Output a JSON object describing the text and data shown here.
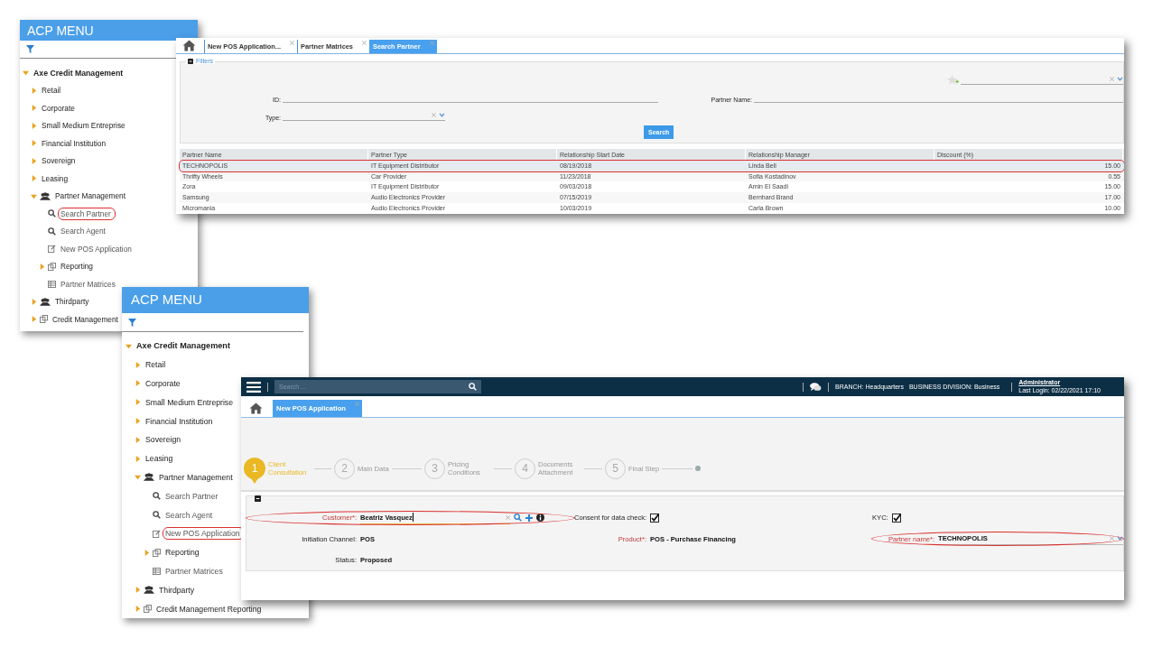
{
  "menus": [
    {
      "title": "ACP MENU",
      "tree": [
        {
          "label": "Axe Credit Management",
          "kind": "root",
          "expanded": true,
          "children": [
            {
              "label": "Retail",
              "kind": "folder",
              "expanded": false
            },
            {
              "label": "Corporate",
              "kind": "folder",
              "expanded": false
            },
            {
              "label": "Small Medium Entreprise",
              "kind": "folder",
              "expanded": false
            },
            {
              "label": "Financial Institution",
              "kind": "folder",
              "expanded": false
            },
            {
              "label": "Sovereign",
              "kind": "folder",
              "expanded": false
            },
            {
              "label": "Leasing",
              "kind": "folder",
              "expanded": false
            },
            {
              "label": "Partner Management",
              "kind": "people",
              "expanded": true,
              "children": [
                {
                  "label": "Search Partner",
                  "kind": "search",
                  "highlighted": true
                },
                {
                  "label": "Search Agent",
                  "kind": "search",
                  "highlighted": false
                },
                {
                  "label": "New POS Application",
                  "kind": "edit",
                  "highlighted": false
                },
                {
                  "label": "Reporting",
                  "kind": "report",
                  "expanded": false
                },
                {
                  "label": "Partner Matrices",
                  "kind": "table",
                  "highlighted": false
                }
              ]
            },
            {
              "label": "Thirdparty",
              "kind": "people",
              "expanded": false
            },
            {
              "label": "Credit Management",
              "kind": "report",
              "expanded": false
            }
          ]
        }
      ]
    },
    {
      "title": "ACP MENU",
      "tree": [
        {
          "label": "Axe Credit Management",
          "kind": "root",
          "expanded": true,
          "children": [
            {
              "label": "Retail",
              "kind": "folder",
              "expanded": false
            },
            {
              "label": "Corporate",
              "kind": "folder",
              "expanded": false
            },
            {
              "label": "Small Medium Entreprise",
              "kind": "folder",
              "expanded": false
            },
            {
              "label": "Financial Institution",
              "kind": "folder",
              "expanded": false
            },
            {
              "label": "Sovereign",
              "kind": "folder",
              "expanded": false
            },
            {
              "label": "Leasing",
              "kind": "folder",
              "expanded": false
            },
            {
              "label": "Partner Management",
              "kind": "people",
              "expanded": true,
              "children": [
                {
                  "label": "Search Partner",
                  "kind": "search",
                  "highlighted": false
                },
                {
                  "label": "Search Agent",
                  "kind": "search",
                  "highlighted": false
                },
                {
                  "label": "New POS Application",
                  "kind": "edit",
                  "highlighted": true
                },
                {
                  "label": "Reporting",
                  "kind": "report",
                  "expanded": false
                },
                {
                  "label": "Partner Matrices",
                  "kind": "table",
                  "highlighted": false
                }
              ]
            },
            {
              "label": "Thirdparty",
              "kind": "people",
              "expanded": false
            },
            {
              "label": "Credit Management Reporting",
              "kind": "report",
              "expanded": false
            }
          ]
        }
      ]
    }
  ],
  "search_window": {
    "tabs": [
      {
        "label": "New POS Application...",
        "selected": false
      },
      {
        "label": "Partner Matrices",
        "selected": false
      },
      {
        "label": "Search Partner",
        "selected": true
      }
    ],
    "filters": {
      "legend": "Filters",
      "expanded": true,
      "id_label": "ID:",
      "partner_name_label": "Partner Name:",
      "type_label": "Type:",
      "search_button": "Search"
    },
    "table": {
      "columns": [
        "Partner Name",
        "Partner Type",
        "Relationship Start Date",
        "Relationship Manager",
        "Discount (%)"
      ],
      "rows": [
        {
          "cells": [
            "TECHNOPOLIS",
            "IT Equipment Distributor",
            "08/19/2018",
            "Linda Bell",
            "15.00"
          ],
          "selected": true,
          "highlighted": true
        },
        {
          "cells": [
            "Thrifty Wheels",
            "Car Provider",
            "11/23/2018",
            "Sofia Kostadinov",
            "0.55"
          ],
          "selected": false,
          "highlighted": false
        },
        {
          "cells": [
            "Zora",
            "IT Equipment Distributor",
            "09/03/2018",
            "Amin El Saadi",
            "15.00"
          ],
          "selected": false,
          "highlighted": false
        },
        {
          "cells": [
            "Samsung",
            "Audio Electronics Provider",
            "07/15/2019",
            "Bernhard Brand",
            "17.00"
          ],
          "selected": false,
          "highlighted": false
        },
        {
          "cells": [
            "Micromania",
            "Audio Electronics Provider",
            "10/03/2019",
            "Carla Brown",
            "10.00"
          ],
          "selected": false,
          "highlighted": false
        }
      ]
    }
  },
  "pos_window": {
    "search": {
      "placeholder": "Search ..."
    },
    "branch": "BRANCH: Headquarters",
    "division": "BUSINESS DIVISION: Business",
    "user": "Administrator",
    "last_login": "Last Login: 02/22/2021 17:10",
    "tabs": [
      {
        "label": "New POS Application",
        "selected": true
      }
    ],
    "steps": [
      {
        "number": "1",
        "label": "Client Consultation",
        "selected": true
      },
      {
        "number": "2",
        "label": "Main Data",
        "selected": false
      },
      {
        "number": "3",
        "label": "Pricing Conditions",
        "selected": false
      },
      {
        "number": "4",
        "label": "Documents Attachment",
        "selected": false
      },
      {
        "number": "5",
        "label": "Final Step",
        "selected": false
      }
    ],
    "form": {
      "expanded": true,
      "rows": [
        {
          "fields": [
            {
              "kind": "lookup",
              "label": "Customer*:",
              "required": true,
              "value": "Beatriz Vasquez",
              "highlighted": true
            },
            {
              "kind": "checkbox",
              "label": "Consent for data check:",
              "checked": true
            },
            {
              "kind": "checkbox",
              "label": "KYC:",
              "checked": true
            }
          ]
        },
        {
          "fields": [
            {
              "kind": "text",
              "label": "Initiation Channel:",
              "required": false,
              "value": "POS"
            },
            {
              "kind": "text",
              "label": "Product*:",
              "required": true,
              "value": "POS - Purchase Financing"
            },
            {
              "kind": "select",
              "label": "Partner name*:",
              "required": true,
              "value": "TECHNOPOLIS",
              "highlighted": true
            }
          ]
        },
        {
          "fields": [
            {
              "kind": "text",
              "label": "Status:",
              "required": false,
              "value": "Proposed"
            }
          ]
        }
      ]
    }
  }
}
